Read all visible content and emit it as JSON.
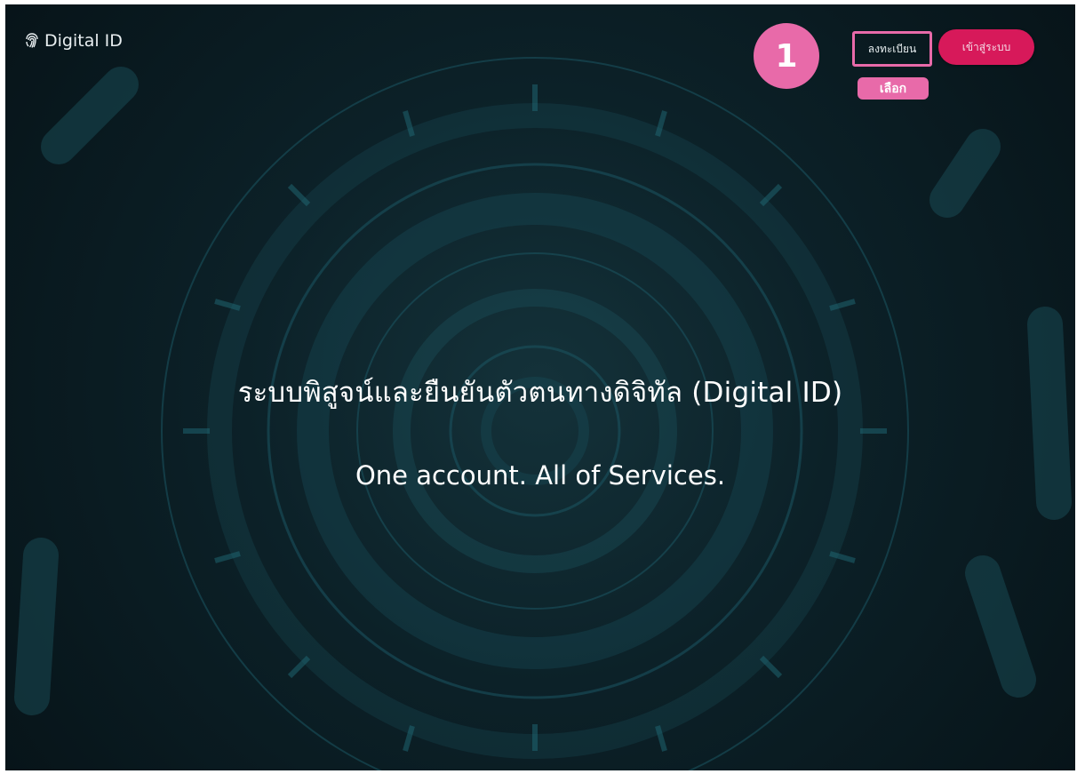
{
  "header": {
    "brand_name": "Digital ID",
    "brand_icon": "fingerprint-icon",
    "step_number": "1",
    "register_label": "ลงทะเบียน",
    "choose_label": "เลือก",
    "login_label": "เข้าสู่ระบบ"
  },
  "hero": {
    "title": "ระบบพิสูจน์และยืนยันตัวตนทางดิจิทัล (Digital ID)",
    "subtitle": "One account. All of Services."
  },
  "colors": {
    "background": "#0c2128",
    "accent_pink": "#e86aa9",
    "login_button": "#d7195a"
  }
}
